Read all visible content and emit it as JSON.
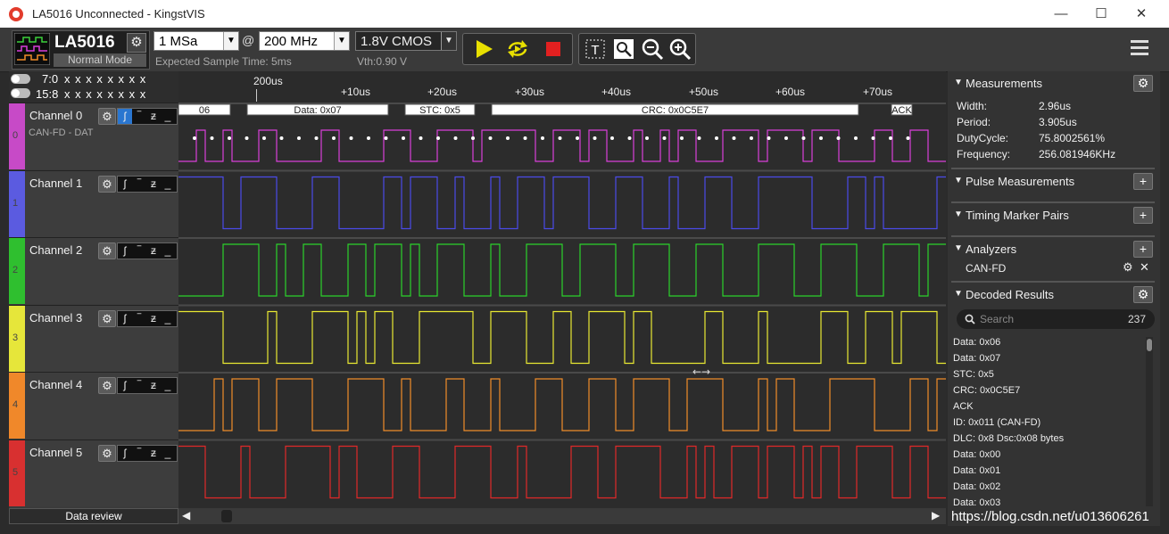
{
  "window": {
    "title": "LA5016 Unconnected - KingstVIS",
    "minimize": "—",
    "maximize": "☐",
    "close": "✕"
  },
  "device": {
    "name": "LA5016",
    "mode": "Normal Mode"
  },
  "samples": {
    "value": "1 MSa",
    "at": "@"
  },
  "rate": {
    "value": "200 MHz"
  },
  "voltage": {
    "value": "1.8V CMOS",
    "vth": "Vth:0.90 V"
  },
  "expected": "Expected Sample Time: 5ms",
  "groups": [
    {
      "label": "7:0",
      "bits": "x x x x x x x x"
    },
    {
      "label": "15:8",
      "bits": "x x x x x x x x"
    }
  ],
  "ruler": [
    "200us",
    "+10us",
    "+20us",
    "+30us",
    "+40us",
    "+50us",
    "+60us",
    "+70us"
  ],
  "channels": [
    {
      "name": "Channel 0",
      "num": "0",
      "sub": "CAN-FD - DAT",
      "color": "#d93fd9",
      "strip": "#c74ac7"
    },
    {
      "name": "Channel 1",
      "num": "1",
      "sub": "",
      "color": "#4a4ae8",
      "strip": "#5b5be0"
    },
    {
      "name": "Channel 2",
      "num": "2",
      "sub": "",
      "color": "#2bd22b",
      "strip": "#2fbf2f"
    },
    {
      "name": "Channel 3",
      "num": "3",
      "sub": "",
      "color": "#e8e832",
      "strip": "#e6e63a"
    },
    {
      "name": "Channel 4",
      "num": "4",
      "sub": "",
      "color": "#f08c2a",
      "strip": "#f0882a"
    },
    {
      "name": "Channel 5",
      "num": "5",
      "sub": "",
      "color": "#e02828",
      "strip": "#d83030"
    }
  ],
  "decode_bars": [
    "06",
    "Data: 0x07",
    "STC: 0x5",
    "CRC: 0x0C5E7",
    "ACK"
  ],
  "data_review": "Data review",
  "measurements": {
    "title": "Measurements",
    "rows": [
      {
        "k": "Width:",
        "v": "2.96us"
      },
      {
        "k": "Period:",
        "v": "3.905us"
      },
      {
        "k": "DutyCycle:",
        "v": "75.8002561%"
      },
      {
        "k": "Frequency:",
        "v": "256.081946KHz"
      }
    ]
  },
  "pulse": "Pulse Measurements",
  "timing": "Timing Marker Pairs",
  "analyzers": {
    "title": "Analyzers",
    "item": "CAN-FD"
  },
  "decoded": {
    "title": "Decoded Results",
    "search": "Search",
    "count": "237",
    "items": [
      "Data: 0x06",
      "Data: 0x07",
      "STC: 0x5",
      "CRC: 0x0C5E7",
      "ACK",
      "ID: 0x011 (CAN-FD)",
      "DLC: 0x8 Dsc:0x08 bytes",
      "Data: 0x00",
      "Data: 0x01",
      "Data: 0x02",
      "Data: 0x03"
    ]
  },
  "watermark": "https://blog.csdn.net/u013606261"
}
